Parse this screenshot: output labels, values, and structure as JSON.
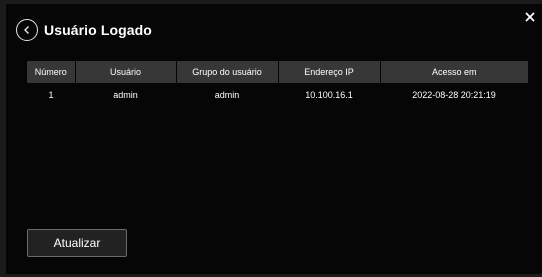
{
  "dialog": {
    "title": "Usuário Logado",
    "back_icon": "chevron-left-circle-icon",
    "close_icon": "close-icon"
  },
  "table": {
    "columns": [
      "Número",
      "Usuário",
      "Grupo do usuário",
      "Endereço IP",
      "Acesso em"
    ],
    "rows": [
      [
        "1",
        "admin",
        "admin",
        "10.100.16.1",
        "2022-08-28 20:21:19"
      ]
    ]
  },
  "actions": {
    "refresh_label": "Atualizar"
  },
  "colors": {
    "background": "#060606",
    "header_row": "#373737",
    "text": "#ffffff"
  }
}
